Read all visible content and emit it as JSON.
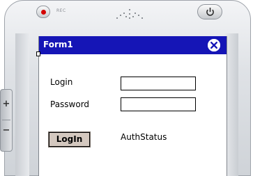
{
  "device": {
    "rec_label": "REC",
    "rocker_plus": "+",
    "rocker_minus": "−"
  },
  "window": {
    "title": "Form1",
    "title_bar_color": "#1515b6",
    "close_icon": "close-circle-icon"
  },
  "form": {
    "login_label": "Login",
    "login_value": "",
    "password_label": "Password",
    "password_value": "",
    "login_button_label": "LogIn",
    "auth_status": "AuthStatus"
  }
}
